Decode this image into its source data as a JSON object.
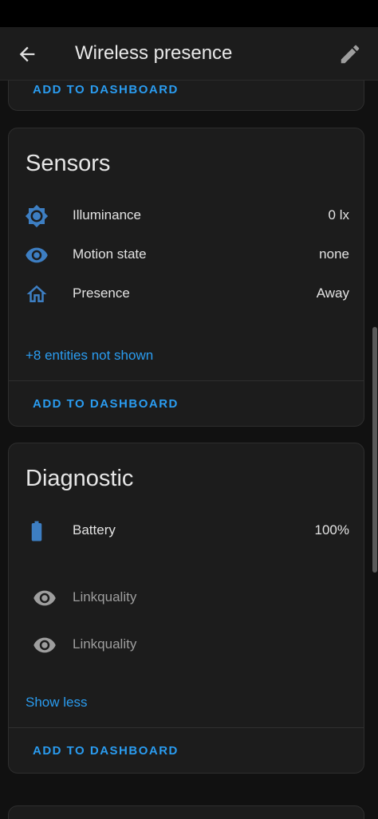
{
  "header": {
    "title": "Wireless presence"
  },
  "top_card": {
    "action_label": "ADD TO DASHBOARD"
  },
  "sensors": {
    "title": "Sensors",
    "rows": [
      {
        "label": "Illuminance",
        "value": "0 lx",
        "icon": "brightness-icon"
      },
      {
        "label": "Motion state",
        "value": "none",
        "icon": "eye-icon"
      },
      {
        "label": "Presence",
        "value": "Away",
        "icon": "home-icon"
      }
    ],
    "more_link": "+8 entities not shown",
    "action_label": "ADD TO DASHBOARD"
  },
  "diagnostic": {
    "title": "Diagnostic",
    "rows": [
      {
        "label": "Battery",
        "value": "100%",
        "icon": "battery-icon"
      },
      {
        "label": "Linkquality",
        "value": "",
        "icon": "eye-icon"
      },
      {
        "label": "Linkquality",
        "value": "",
        "icon": "eye-icon"
      }
    ],
    "less_link": "Show less",
    "action_label": "ADD TO DASHBOARD"
  },
  "colors": {
    "accent": "#2a9cf0",
    "icon_blue": "#3d7ec2",
    "background": "#111111",
    "card": "#1c1c1c"
  }
}
